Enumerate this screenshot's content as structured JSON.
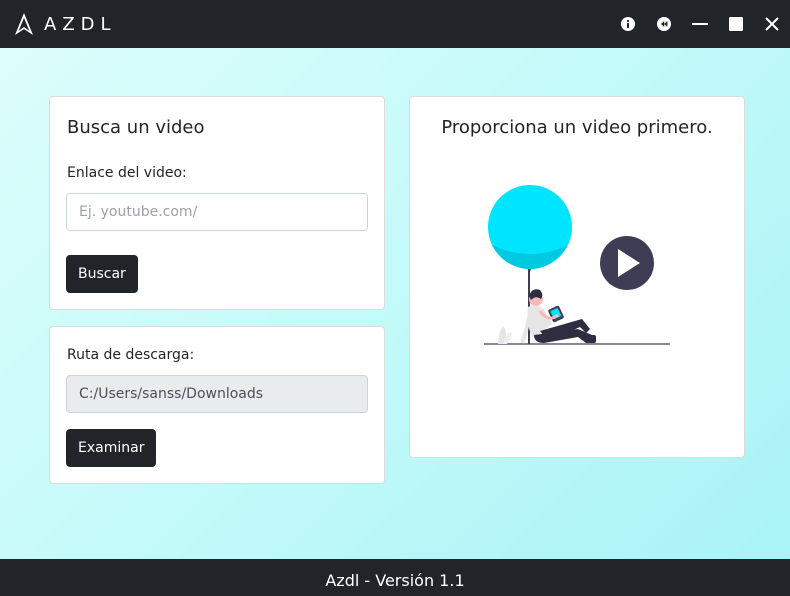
{
  "app": {
    "name": "AZDL",
    "logo_icon": "azdl-logo-icon"
  },
  "window_controls": [
    {
      "name": "info-icon"
    },
    {
      "name": "back-icon"
    },
    {
      "name": "minimize-icon"
    },
    {
      "name": "maximize-icon"
    },
    {
      "name": "close-icon"
    }
  ],
  "search_card": {
    "title": "Busca un video",
    "link_label": "Enlace del video:",
    "link_value": "",
    "link_placeholder": "Ej. youtube.com/",
    "search_button": "Buscar"
  },
  "path_card": {
    "label": "Ruta de descarga:",
    "path_value": "C:/Users/sanss/Downloads",
    "browse_button": "Examinar"
  },
  "preview_card": {
    "title": "Proporciona un video primero.",
    "illustration": "person-watching-video-illustration"
  },
  "footer": {
    "version_text": "Azdl - Versión 1.1"
  },
  "colors": {
    "titlebar": "#212529",
    "accent_cyan": "#00e5ff",
    "play_button": "#3f3d56",
    "background_gradient_start": "#dcfdfb",
    "background_gradient_end": "#a9f3f6"
  }
}
